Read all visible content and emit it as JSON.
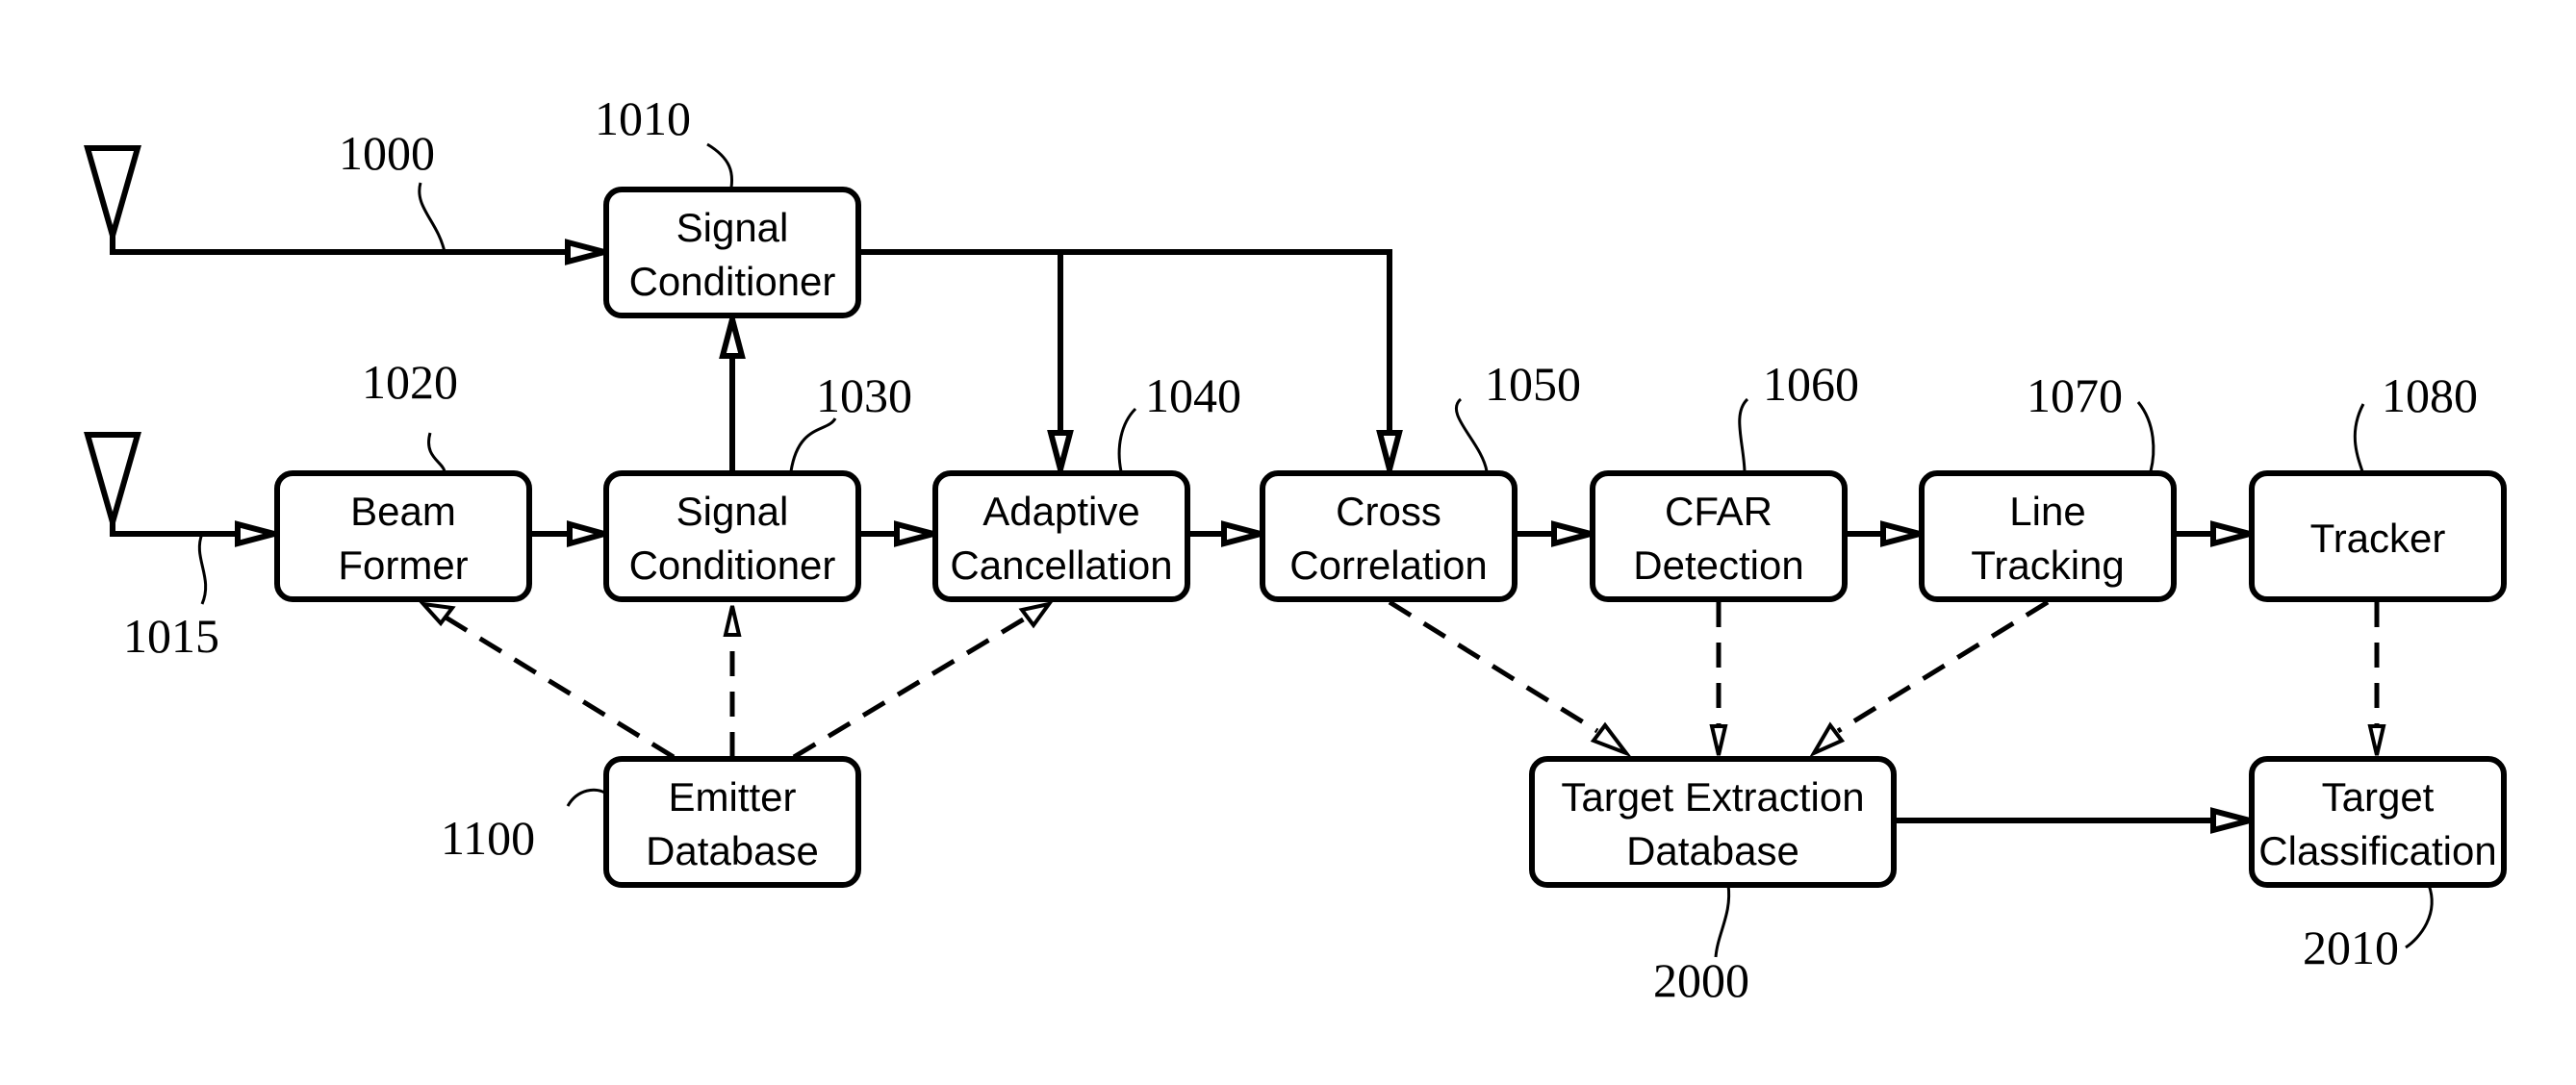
{
  "diagram": {
    "type": "signal-processing block diagram",
    "antennas": [
      {
        "id": "antenna-1",
        "ref": "1000"
      },
      {
        "id": "antenna-2",
        "ref": "1015"
      }
    ],
    "blocks": [
      {
        "id": "signal-conditioner-top",
        "ref": "1010",
        "lines": [
          "Signal",
          "Conditioner"
        ]
      },
      {
        "id": "beam-former",
        "ref": "1020",
        "lines": [
          "Beam",
          "Former"
        ]
      },
      {
        "id": "signal-conditioner",
        "ref": "1030",
        "lines": [
          "Signal",
          "Conditioner"
        ]
      },
      {
        "id": "adaptive-cancellation",
        "ref": "1040",
        "lines": [
          "Adaptive",
          "Cancellation"
        ]
      },
      {
        "id": "cross-correlation",
        "ref": "1050",
        "lines": [
          "Cross",
          "Correlation"
        ]
      },
      {
        "id": "cfar-detection",
        "ref": "1060",
        "lines": [
          "CFAR",
          "Detection"
        ]
      },
      {
        "id": "line-tracking",
        "ref": "1070",
        "lines": [
          "Line",
          "Tracking"
        ]
      },
      {
        "id": "tracker",
        "ref": "1080",
        "lines": [
          "Tracker"
        ]
      },
      {
        "id": "emitter-database",
        "ref": "1100",
        "lines": [
          "Emitter",
          "Database"
        ]
      },
      {
        "id": "target-extraction-database",
        "ref": "2000",
        "lines": [
          "Target Extraction",
          "Database"
        ]
      },
      {
        "id": "target-classification",
        "ref": "2010",
        "lines": [
          "Target",
          "Classification"
        ]
      }
    ],
    "connections": [
      {
        "from": "antenna-1",
        "to": "signal-conditioner-top",
        "style": "solid"
      },
      {
        "from": "antenna-2",
        "to": "beam-former",
        "style": "solid"
      },
      {
        "from": "beam-former",
        "to": "signal-conditioner",
        "style": "solid"
      },
      {
        "from": "signal-conditioner",
        "to": "signal-conditioner-top",
        "style": "solid"
      },
      {
        "from": "signal-conditioner",
        "to": "adaptive-cancellation",
        "style": "solid"
      },
      {
        "from": "signal-conditioner-top",
        "to": "adaptive-cancellation",
        "style": "solid"
      },
      {
        "from": "signal-conditioner-top",
        "to": "cross-correlation",
        "style": "solid"
      },
      {
        "from": "adaptive-cancellation",
        "to": "cross-correlation",
        "style": "solid"
      },
      {
        "from": "cross-correlation",
        "to": "cfar-detection",
        "style": "solid"
      },
      {
        "from": "cfar-detection",
        "to": "line-tracking",
        "style": "solid"
      },
      {
        "from": "line-tracking",
        "to": "tracker",
        "style": "solid"
      },
      {
        "from": "emitter-database",
        "to": "beam-former",
        "style": "dashed"
      },
      {
        "from": "emitter-database",
        "to": "signal-conditioner",
        "style": "dashed"
      },
      {
        "from": "emitter-database",
        "to": "adaptive-cancellation",
        "style": "dashed"
      },
      {
        "from": "cross-correlation",
        "to": "target-extraction-database",
        "style": "dashed"
      },
      {
        "from": "cfar-detection",
        "to": "target-extraction-database",
        "style": "dashed"
      },
      {
        "from": "line-tracking",
        "to": "target-extraction-database",
        "style": "dashed"
      },
      {
        "from": "tracker",
        "to": "target-classification",
        "style": "dashed"
      },
      {
        "from": "target-extraction-database",
        "to": "target-classification",
        "style": "solid"
      }
    ]
  }
}
